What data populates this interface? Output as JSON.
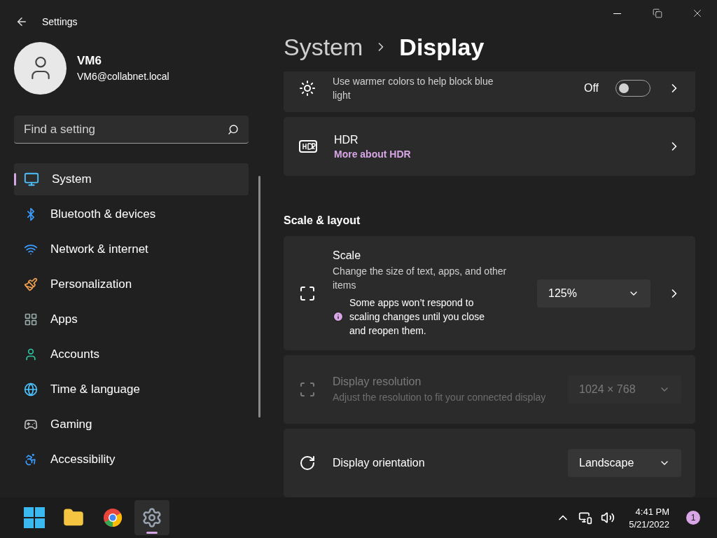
{
  "window": {
    "title": "Settings"
  },
  "account": {
    "name": "VM6",
    "email": "VM6@collabnet.local"
  },
  "search": {
    "placeholder": "Find a setting"
  },
  "nav": [
    {
      "label": "System",
      "selected": true
    },
    {
      "label": "Bluetooth & devices",
      "selected": false
    },
    {
      "label": "Network & internet",
      "selected": false
    },
    {
      "label": "Personalization",
      "selected": false
    },
    {
      "label": "Apps",
      "selected": false
    },
    {
      "label": "Accounts",
      "selected": false
    },
    {
      "label": "Time & language",
      "selected": false
    },
    {
      "label": "Gaming",
      "selected": false
    },
    {
      "label": "Accessibility",
      "selected": false
    }
  ],
  "breadcrumb": {
    "parent": "System",
    "current": "Display"
  },
  "settings": [
    {
      "kind": "toggle",
      "description": "Use warmer colors to help block blue light",
      "state_label": "Off",
      "on": false,
      "expandable": true
    },
    {
      "kind": "link",
      "title": "HDR",
      "link": "More about HDR",
      "expandable": true
    },
    {
      "kind": "heading",
      "title": "Scale & layout"
    },
    {
      "kind": "dropdown",
      "title": "Scale",
      "description": "Change the size of text, apps, and other items",
      "note": "Some apps won’t respond to scaling changes until you close and reopen them.",
      "value": "125%",
      "disabled": false,
      "expandable": true
    },
    {
      "kind": "dropdown",
      "title": "Display resolution",
      "description": "Adjust the resolution to fit your connected display",
      "value": "1024 × 768",
      "disabled": true,
      "expandable": false
    },
    {
      "kind": "dropdown",
      "title": "Display orientation",
      "value": "Landscape",
      "disabled": false,
      "expandable": false
    }
  ],
  "taskbar": {
    "apps": [
      {
        "selected": false
      },
      {
        "selected": false
      },
      {
        "selected": false
      },
      {
        "selected": true
      }
    ],
    "time": "4:41 PM",
    "date": "5/21/2022",
    "notifications": "1"
  }
}
